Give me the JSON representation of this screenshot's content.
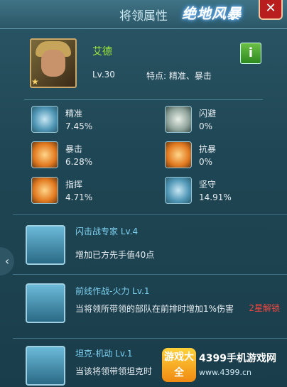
{
  "header": {
    "title": "将领属性",
    "logo_text": "绝地风暴",
    "close_label": "✕"
  },
  "general": {
    "name": "艾德",
    "level": "Lv.30",
    "traits": "特点: 精准、暴击",
    "info_label": "i"
  },
  "stats": [
    {
      "label": "精准",
      "value": "7.45%",
      "icon": "target-icon"
    },
    {
      "label": "闪避",
      "value": "0%",
      "icon": "tank-icon"
    },
    {
      "label": "暴击",
      "value": "6.28%",
      "icon": "rocket-icon"
    },
    {
      "label": "抗暴",
      "value": "0%",
      "icon": "shield-orange-icon"
    },
    {
      "label": "指挥",
      "value": "4.71%",
      "icon": "missile-icon"
    },
    {
      "label": "坚守",
      "value": "14.91%",
      "icon": "star-shield-icon"
    }
  ],
  "skills": [
    {
      "name": "闪击战专家 Lv.4",
      "desc": "增加已方先手值40点",
      "lock": ""
    },
    {
      "name": "前线作战-火力 Lv.1",
      "desc": "当将领所带领的部队在前排时增加1%伤害",
      "lock": "2星解锁"
    },
    {
      "name": "坦克-机动 Lv.1",
      "desc": "当该将领带领坦克时",
      "lock": ""
    }
  ],
  "watermark": {
    "badge": "游戏大全",
    "site": "4399手机游戏网",
    "url": "www.4399.cn"
  },
  "colors": {
    "accent_green": "#9ee83a",
    "skill_blue": "#7fd3f3",
    "lock_red": "#f0473f"
  }
}
